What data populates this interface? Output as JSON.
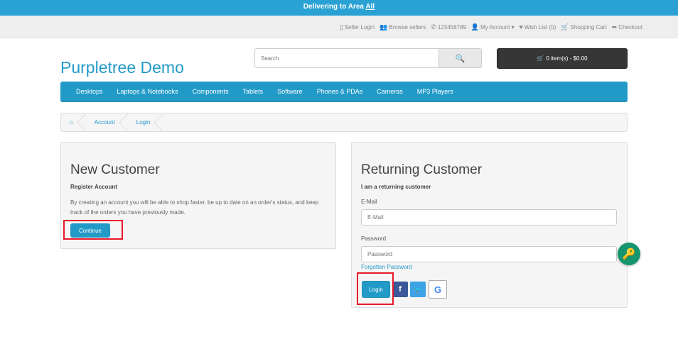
{
  "topbar": {
    "prefix": "Delivering to Area",
    "area": "All"
  },
  "util": {
    "links": [
      {
        "icon": "mobile-icon",
        "glyph": "▯",
        "label": "Seller Login"
      },
      {
        "icon": "users-icon",
        "glyph": "👥",
        "label": "Browse sellers"
      },
      {
        "icon": "phone-icon",
        "glyph": "✆",
        "label": "123456789"
      },
      {
        "icon": "user-icon",
        "glyph": "👤",
        "label": "My Account",
        "caret": "▾"
      },
      {
        "icon": "heart-icon",
        "glyph": "♥",
        "label": "Wish List (0)"
      },
      {
        "icon": "cart-icon",
        "glyph": "🛒",
        "label": "Shopping Cart"
      },
      {
        "icon": "share-icon",
        "glyph": "➦",
        "label": "Checkout"
      }
    ]
  },
  "header": {
    "logo": "Purpletree Demo",
    "search_placeholder": "Search",
    "search_glyph": "🔍",
    "cart_label": "0 item(s) - $0.00",
    "cart_glyph": "🛒"
  },
  "menu": [
    "Desktops",
    "Laptops & Notebooks",
    "Components",
    "Tablets",
    "Software",
    "Phones & PDAs",
    "Cameras",
    "MP3 Players"
  ],
  "breadcrumb": {
    "home_glyph": "⌂",
    "items": [
      "Account",
      "Login"
    ]
  },
  "new_customer": {
    "title": "New Customer",
    "subtitle": "Register Account",
    "description": "By creating an account you will be able to shop faster, be up to date on an order's status, and keep track of the orders you have previously made.",
    "button": "Continue"
  },
  "returning_customer": {
    "title": "Returning Customer",
    "subtitle": "I am a returning customer",
    "email_label": "E-Mail",
    "email_placeholder": "E-Mail",
    "password_label": "Password",
    "password_placeholder": "Password",
    "forgot": "Forgotten Password",
    "button": "Login",
    "social": {
      "facebook": "f",
      "twitter": "🐦",
      "google": "G"
    }
  },
  "colors": {
    "accent": "#229ac8",
    "topbar": "#2aa1d3",
    "highlight": "#e8182a",
    "key_badge": "#14956f"
  },
  "key_badge_glyph": "🔑"
}
